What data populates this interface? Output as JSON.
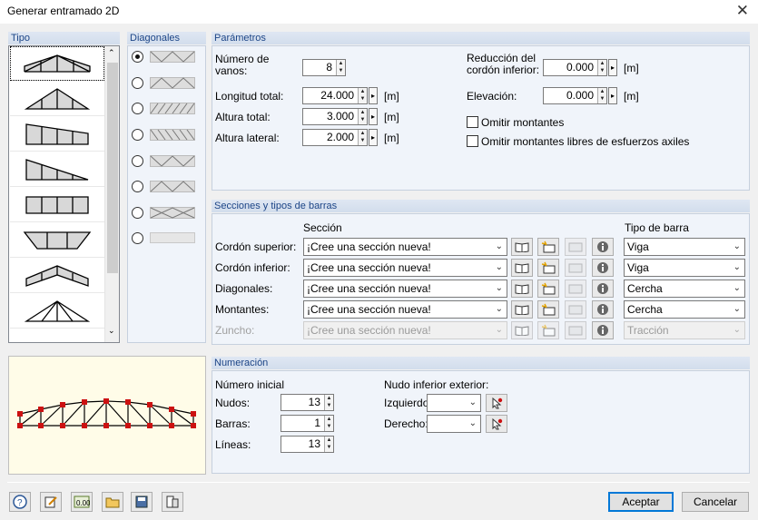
{
  "window": {
    "title": "Generar entramado 2D",
    "close": "✕"
  },
  "tipo": {
    "header": "Tipo"
  },
  "diagonales": {
    "header": "Diagonales"
  },
  "parametros": {
    "header": "Parámetros",
    "num_vanos_label_1": "Número de",
    "num_vanos_label_2": "vanos:",
    "num_vanos": "8",
    "longitud_label": "Longitud total:",
    "longitud": "24.000",
    "altura_label": "Altura total:",
    "altura": "3.000",
    "lateral_label": "Altura lateral:",
    "lateral": "2.000",
    "unit": "[m]",
    "reduccion_label_1": "Reducción del",
    "reduccion_label_2": "cordón inferior:",
    "reduccion": "0.000",
    "elevacion_label": "Elevación:",
    "elevacion": "0.000",
    "omitir_montantes": "Omitir montantes",
    "omitir_libres": "Omitir montantes libres de esfuerzos axiles"
  },
  "secciones": {
    "header": "Secciones y tipos de barras",
    "col_seccion": "Sección",
    "col_tipo": "Tipo de barra",
    "rows": [
      {
        "label": "Cordón superior:",
        "section": "¡Cree una sección nueva!",
        "type": "Viga"
      },
      {
        "label": "Cordón inferior:",
        "section": "¡Cree una sección nueva!",
        "type": "Viga"
      },
      {
        "label": "Diagonales:",
        "section": "¡Cree una sección nueva!",
        "type": "Cercha"
      },
      {
        "label": "Montantes:",
        "section": "¡Cree una sección nueva!",
        "type": "Cercha"
      },
      {
        "label": "Zuncho:",
        "section": "¡Cree una sección nueva!",
        "type": "Tracción"
      }
    ]
  },
  "numeracion": {
    "header": "Numeración",
    "inicial": "Número inicial",
    "nudos_label": "Nudos:",
    "nudos": "13",
    "barras_label": "Barras:",
    "barras": "1",
    "lineas_label": "Líneas:",
    "lineas": "13",
    "nudo_inf": "Nudo inferior exterior:",
    "izq_label": "Izquierdo:",
    "der_label": "Derecho:"
  },
  "buttons": {
    "aceptar": "Aceptar",
    "cancelar": "Cancelar"
  },
  "toolbar_icons": [
    "help-icon",
    "edit-icon",
    "units-icon",
    "open-icon",
    "save-icon",
    "import-icon"
  ],
  "colors": {
    "node": "#cc1111",
    "header_text": "#1c4587",
    "accent": "#0078d7"
  }
}
